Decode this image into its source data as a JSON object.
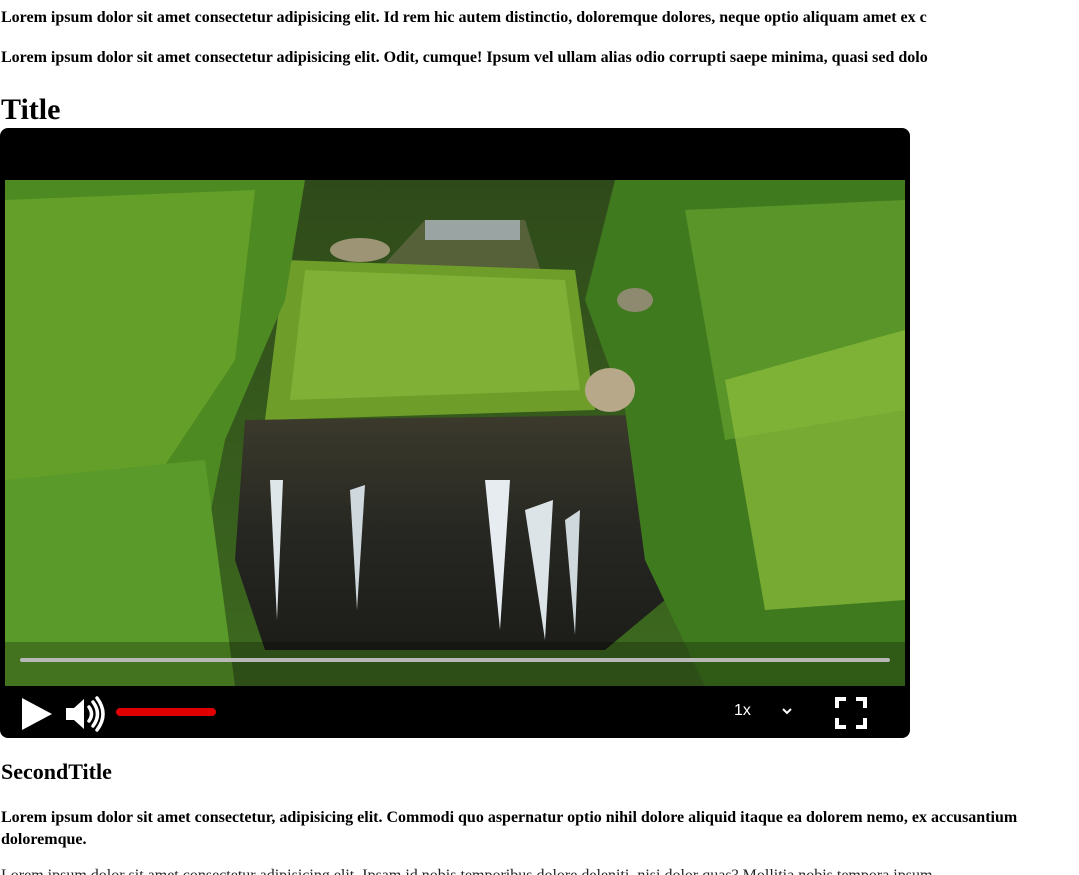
{
  "paragraphs": {
    "p1": "Lorem ipsum dolor sit amet consectetur adipisicing elit. Id rem hic autem distinctio, doloremque dolores, neque optio aliquam amet ex c",
    "p2": "Lorem ipsum dolor sit amet consectetur adipisicing elit. Odit, cumque! Ipsum vel ullam alias odio corrupti saepe minima, quasi sed dolo",
    "p3": "Lorem ipsum dolor sit amet consectetur, adipisicing elit. Commodi quo aspernatur optio nihil dolore aliquid itaque ea dolorem nemo, ex accusantium doloremque.",
    "p4": "Lorem ipsum dolor sit amet consectetur adipisicing elit. Ipsam id nobis temporibus dolore deleniti, nisi dolor quas? Mollitia nobis tempora ipsum."
  },
  "headings": {
    "title": "Title",
    "second_title": "SecondTitle"
  },
  "player": {
    "progress": 0,
    "volume": 1.0,
    "speed": "1x",
    "colors": {
      "volume_fill": "#e00000",
      "progress_track": "#b8b8b8",
      "controls_bg": "#000000"
    },
    "icons": {
      "play": "play-icon",
      "volume": "volume-high-icon",
      "speed_menu": "chevron-down-icon",
      "fullscreen": "fullscreen-icon"
    }
  }
}
